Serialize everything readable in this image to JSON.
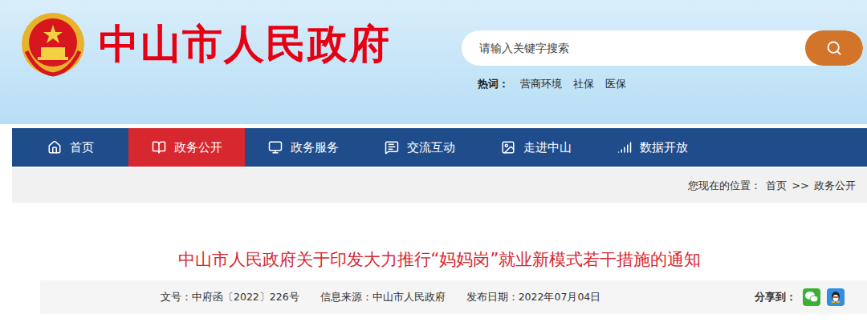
{
  "site": {
    "title": "中山市人民政府"
  },
  "search": {
    "placeholder": "请输入关键字搜索"
  },
  "hot_words": {
    "label": "热词：",
    "items": [
      "营商环境",
      "社保",
      "医保"
    ]
  },
  "nav": [
    {
      "label": "首页",
      "selected": false
    },
    {
      "label": "政务公开",
      "selected": true
    },
    {
      "label": "政务服务",
      "selected": false
    },
    {
      "label": "交流互动",
      "selected": false
    },
    {
      "label": "走进中山",
      "selected": false
    },
    {
      "label": "数据开放",
      "selected": false
    }
  ],
  "breadcrumb": {
    "label": "您现在的位置：",
    "items": [
      "首页",
      "政务公开"
    ],
    "separator": ">>"
  },
  "article": {
    "title": "中山市人民政府关于印发大力推行“妈妈岗”就业新模式若干措施的通知",
    "meta": [
      {
        "label": "文号：",
        "value": "中府函〔2022〕226号"
      },
      {
        "label": "信息来源：",
        "value": "中山市人民政府"
      },
      {
        "label": "发布日期：",
        "value": "2022年07月04日"
      }
    ]
  },
  "share": {
    "label": "分享到："
  }
}
